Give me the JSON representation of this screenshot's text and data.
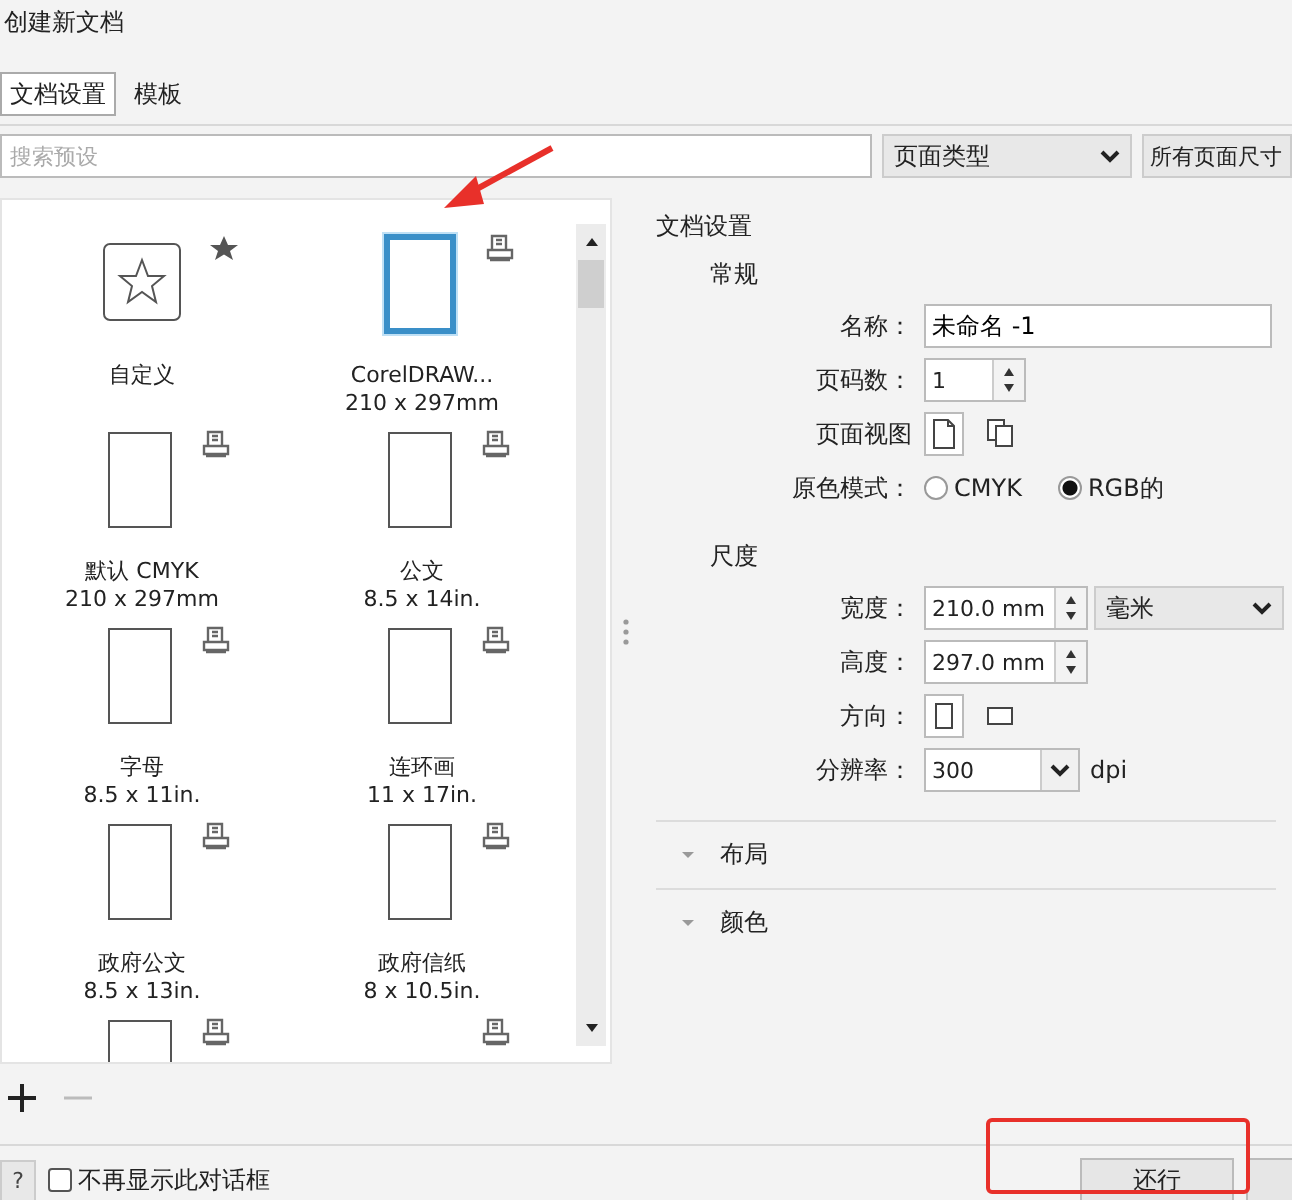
{
  "window": {
    "title": "创建新文档"
  },
  "tabs": [
    {
      "label": "文档设置",
      "selected": true
    },
    {
      "label": "模板",
      "selected": false
    }
  ],
  "search": {
    "placeholder": "搜索预设"
  },
  "filters": {
    "page_type": "页面类型",
    "page_size": "所有页面尺寸"
  },
  "presets": [
    {
      "kind": "custom",
      "name": "自定义",
      "selected": false
    },
    {
      "kind": "page",
      "name": "CorelDRAW...",
      "size": "210 x 297mm",
      "selected": true
    },
    {
      "kind": "page",
      "name": "默认 CMYK",
      "size": "210 x 297mm",
      "selected": false
    },
    {
      "kind": "page",
      "name": "公文",
      "size": "8.5 x 14in.",
      "selected": false
    },
    {
      "kind": "page",
      "name": "字母",
      "size": "8.5 x 11in.",
      "selected": false
    },
    {
      "kind": "page",
      "name": "连环画",
      "size": "11 x 17in.",
      "selected": false
    },
    {
      "kind": "page",
      "name": "政府公文",
      "size": "8.5 x 13in.",
      "selected": false
    },
    {
      "kind": "page",
      "name": "政府信纸",
      "size": "8 x 10.5in.",
      "selected": false
    },
    {
      "kind": "page",
      "selected": false
    },
    {
      "kind": "printer-only",
      "selected": false
    }
  ],
  "settings": {
    "title": "文档设置",
    "general": {
      "heading": "常规",
      "name_label": "名称：",
      "name_value": "未命名 -1",
      "pages_label": "页码数：",
      "pages_value": "1",
      "view_label": "页面视图",
      "views": [
        {
          "kind": "single",
          "selected": true
        },
        {
          "kind": "multi",
          "selected": false
        }
      ],
      "color_label": "原色模式：",
      "color_modes": [
        {
          "label": "CMYK",
          "selected": false
        },
        {
          "label": "RGB的",
          "selected": true
        }
      ]
    },
    "dimensions": {
      "heading": "尺度",
      "width_label": "宽度：",
      "width_value": "210.0 mm",
      "unit": "毫米",
      "height_label": "高度：",
      "height_value": "297.0 mm",
      "orientation_label": "方向：",
      "orientations": [
        {
          "kind": "portrait",
          "selected": true
        },
        {
          "kind": "landscape",
          "selected": false
        }
      ],
      "resolution_label": "分辨率：",
      "resolution_value": "300",
      "resolution_unit": "dpi"
    },
    "sections": [
      {
        "label": "布局",
        "expanded": false
      },
      {
        "label": "颜色",
        "expanded": false
      }
    ]
  },
  "footer": {
    "help": "?",
    "dont_show_label": "不再显示此对话框",
    "dont_show_checked": false,
    "ok": "还行"
  },
  "annotations": {
    "arrow": true,
    "highlight_box": true
  }
}
